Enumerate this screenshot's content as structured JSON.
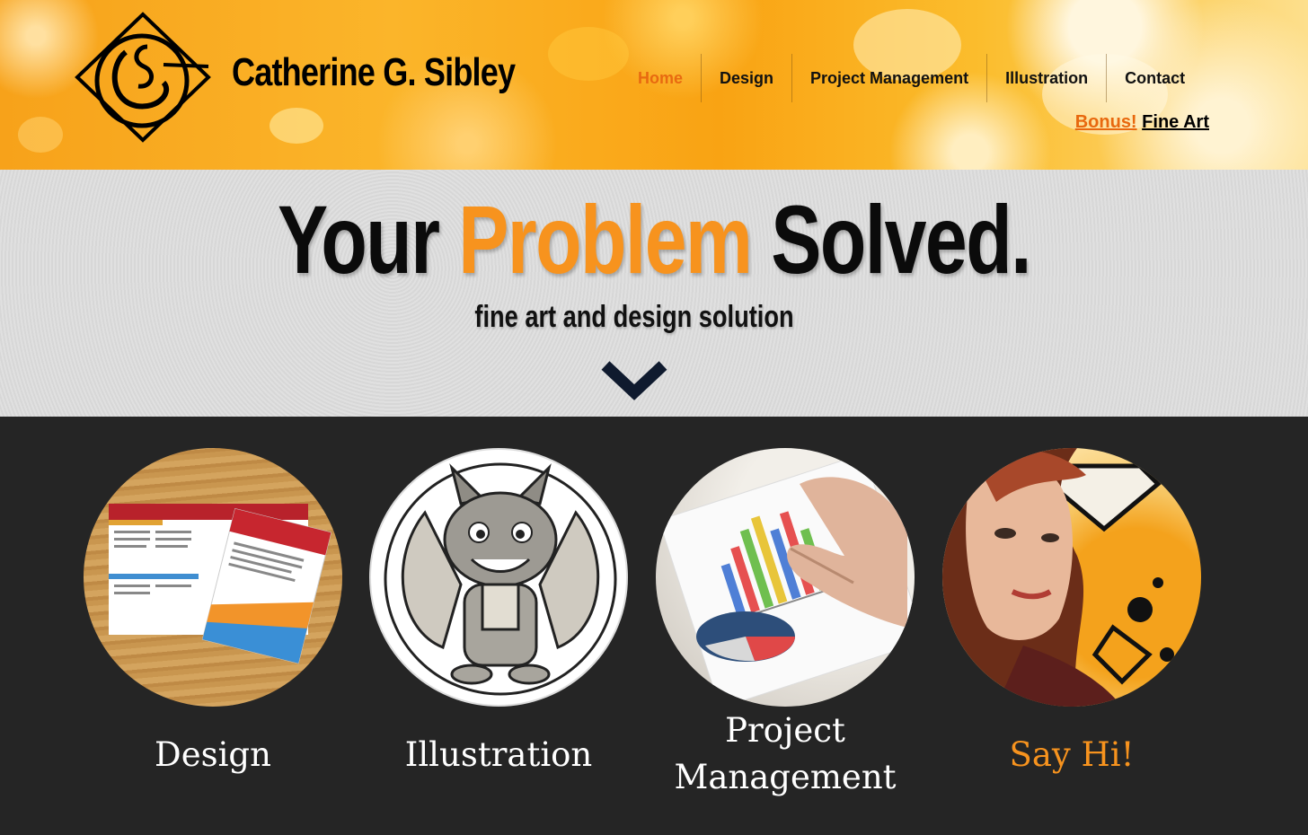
{
  "header": {
    "site_title": "Catherine G. Sibley",
    "nav": [
      {
        "label": "Home",
        "active": true
      },
      {
        "label": "Design",
        "active": false
      },
      {
        "label": "Project Management",
        "active": false
      },
      {
        "label": "Illustration",
        "active": false
      },
      {
        "label": "Contact",
        "active": false
      }
    ],
    "bonus_label": "Bonus!",
    "bonus_link": "Fine Art"
  },
  "hero": {
    "headline_part1": "Your",
    "headline_accent": "Problem",
    "headline_part2": "Solved.",
    "subtitle": "fine art and design solution",
    "scroll_icon": "chevron-down-icon"
  },
  "services": [
    {
      "label": "Design",
      "image": "brochure-flyers-on-wood"
    },
    {
      "label": "Illustration",
      "image": "cartoon-gargoyle"
    },
    {
      "label_line1": "Project",
      "label_line2": "Management",
      "image": "hand-pointing-at-charts"
    },
    {
      "label": "Say Hi!",
      "image": "stylized-portrait"
    }
  ],
  "colors": {
    "accent": "#f7931e",
    "nav_active": "#e86a10",
    "dark_bg": "#252525",
    "hero_bg": "#dedede"
  }
}
